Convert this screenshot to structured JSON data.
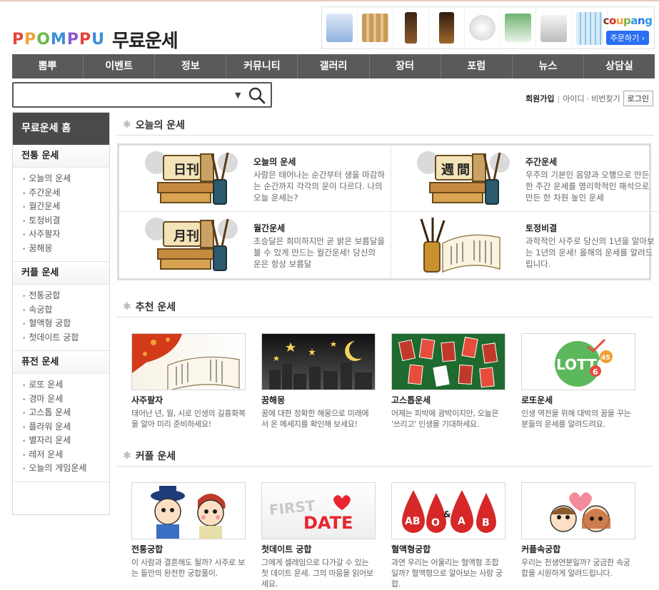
{
  "header": {
    "logo_text": "PPOMPPU",
    "page_title": "무료운세",
    "ad_brand": "coupang",
    "ad_cta": "주문하기 ›"
  },
  "nav": [
    "뽐뿌",
    "이벤트",
    "정보",
    "커뮤니티",
    "갤러리",
    "장터",
    "포럼",
    "뉴스",
    "상담실"
  ],
  "search": {
    "placeholder": "",
    "caret": "▼"
  },
  "account": {
    "join": "회원가입",
    "id": "아이디",
    "dot": "·",
    "pw": "비번찾기",
    "login": "로그인"
  },
  "sidebar": {
    "home": "무료운세 홈",
    "sections": [
      {
        "title": "전통 운세",
        "items": [
          "오늘의 운세",
          "주간운세",
          "월간운세",
          "토정비결",
          "사주팔자",
          "꿈해몽"
        ]
      },
      {
        "title": "커플 운세",
        "items": [
          "전통궁합",
          "속궁합",
          "혈액형 궁합",
          "첫데이트 궁합"
        ]
      },
      {
        "title": "퓨전 운세",
        "items": [
          "로또 운세",
          "경마 운세",
          "고스톱 운세",
          "플라워 운세",
          "별자리 운세",
          "레저 운세",
          "오늘의 게임운세"
        ]
      }
    ]
  },
  "today": {
    "title": "오늘의 운세",
    "items": [
      {
        "title": "오늘의 운세",
        "desc": "사람은 태어나는 순간부터 생을 마감하는 순간까지 각각의 운이 다르다. 나의 오늘 운세는?",
        "glyph1": "日",
        "glyph2": "刊"
      },
      {
        "title": "주간운세",
        "desc": "우주의 기본인 음양과 오행으로 만든 한 주간 운세를 명리학적인 해석으로 만든 한 차원 높인 운세",
        "glyph1": "週",
        "glyph2": "間"
      },
      {
        "title": "월간운세",
        "desc": "초승달은 희미하지만 곧 밝은 보름달을 볼 수 있게 만드는 월간운세! 당신의 운은 항상 보름달",
        "glyph1": "月",
        "glyph2": "刊"
      },
      {
        "title": "토정비결",
        "desc": "과학적인 사주로 당신의 1년을 알아보는 1년의 운세! 올해의 운세를 알려드립니다.",
        "glyph1": "",
        "glyph2": ""
      }
    ]
  },
  "recommend": {
    "title": "추천 운세",
    "cards": [
      {
        "title": "사주팔자",
        "desc": "태어난 년, 월, 시로 인생의 길흉화복을 알아 미리 준비하세요!"
      },
      {
        "title": "꿈해몽",
        "desc": "꿈에 대한 정확한 해몽으로 미래에서 온 메세지를 확인해 보세요!"
      },
      {
        "title": "고스톱운세",
        "desc": "어제는 피박에 광박이지만, 오늘은 '쓰리고' 인생을 기대하세요."
      },
      {
        "title": "로또운세",
        "desc": "인생 역전을 위해 대박의 꿈을 꾸는 분들의 운세를 알려드려요."
      }
    ],
    "lotto_logo": "LOTTO",
    "lotto_num": "6",
    "lotto_sub": "45"
  },
  "couple": {
    "title": "커플 운세",
    "cards": [
      {
        "title": "전통궁합",
        "desc": "이 사람과 결혼해도 될까? 사주로 보는 들만의 완전한 궁합풀이."
      },
      {
        "title": "첫데이트 궁합",
        "desc": "그에게 셀레임으로 다가갈 수 있는 첫 데이트 운세. 그의 마음을 읽어보세요."
      },
      {
        "title": "혈액형궁합",
        "desc": "과연 우리는 어울리는 혈액형 조합일까? 혈액형으로 알아보는 사랑 궁합."
      },
      {
        "title": "커플속궁합",
        "desc": "우리는 천생연분일까? 궁금한 속궁합을 시원하게 알려드립니다."
      }
    ],
    "first": "FIRST",
    "date": "DATE",
    "blood": [
      "AB",
      "O",
      "&",
      "A",
      "B"
    ]
  },
  "colors": {
    "nav_bg": "#5a5a5a",
    "side_head": "#4a4a4a",
    "accent_red": "#e8252e",
    "coupang_blue": "#2b6ff2"
  }
}
